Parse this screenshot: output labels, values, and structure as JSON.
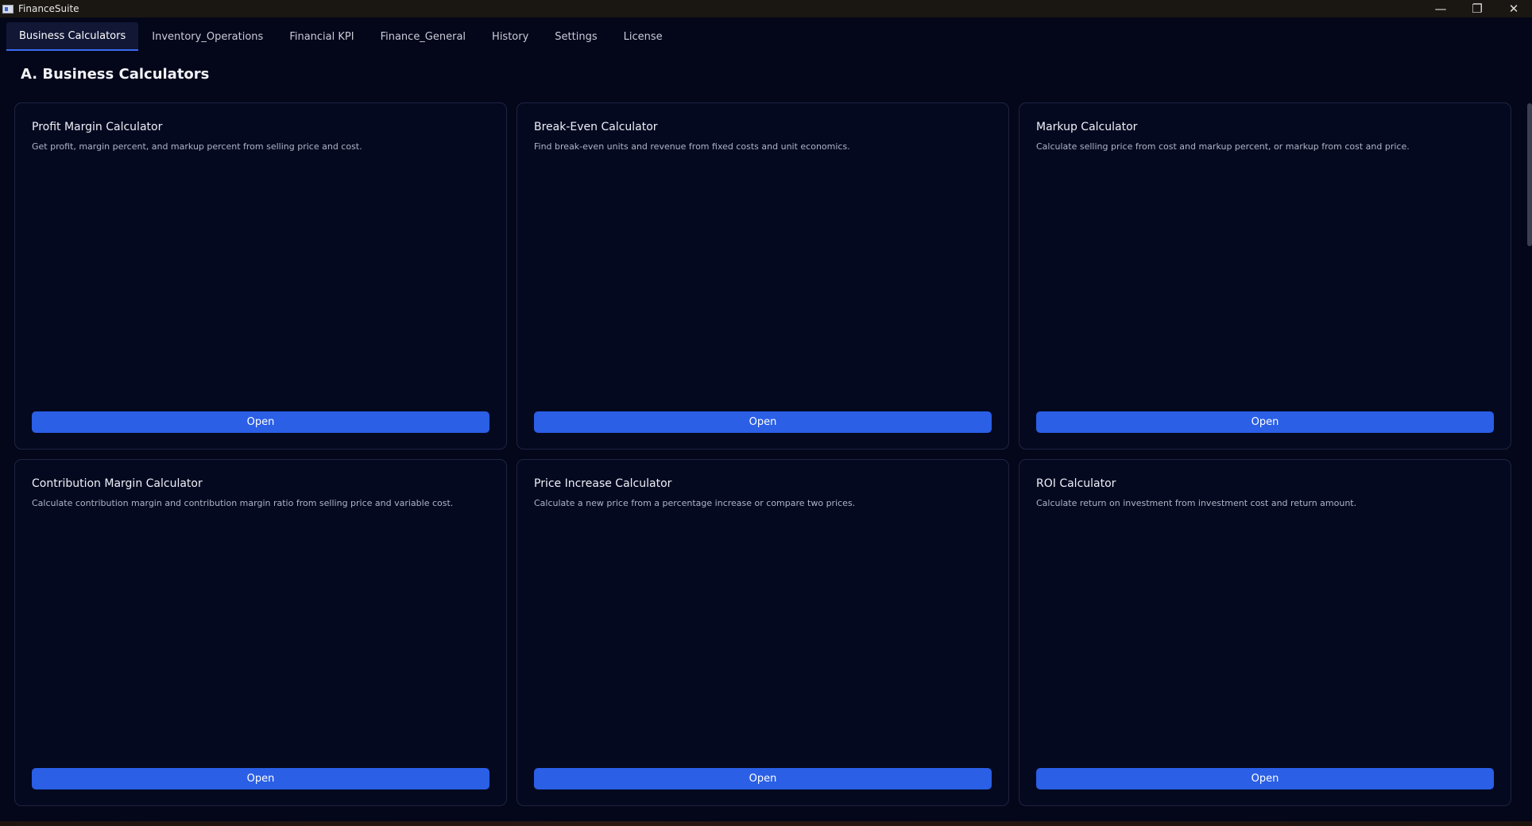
{
  "window": {
    "title": "FinanceSuite",
    "controls": {
      "minimize": "—",
      "restore": "❐",
      "close": "✕"
    }
  },
  "tabs": [
    {
      "label": "Business Calculators",
      "active": true
    },
    {
      "label": "Inventory_Operations",
      "active": false
    },
    {
      "label": "Financial KPI",
      "active": false
    },
    {
      "label": "Finance_General",
      "active": false
    },
    {
      "label": "History",
      "active": false
    },
    {
      "label": "Settings",
      "active": false
    },
    {
      "label": "License",
      "active": false
    }
  ],
  "page": {
    "heading": "A. Business Calculators"
  },
  "cards": [
    {
      "title": "Profit Margin Calculator",
      "description": "Get profit, margin percent, and markup percent from selling price and cost.",
      "button_label": "Open"
    },
    {
      "title": "Break-Even Calculator",
      "description": "Find break-even units and revenue from fixed costs and unit economics.",
      "button_label": "Open"
    },
    {
      "title": "Markup Calculator",
      "description": "Calculate selling price from cost and markup percent, or markup from cost and price.",
      "button_label": "Open"
    },
    {
      "title": "Contribution Margin Calculator",
      "description": "Calculate contribution margin and contribution margin ratio from selling price and variable cost.",
      "button_label": "Open"
    },
    {
      "title": "Price Increase Calculator",
      "description": "Calculate a new price from a percentage increase or compare two prices.",
      "button_label": "Open"
    },
    {
      "title": "ROI Calculator",
      "description": "Calculate return on investment from investment cost and return amount.",
      "button_label": "Open"
    }
  ],
  "colors": {
    "background": "#04061a",
    "card_background": "#050920",
    "accent": "#2a5fe6",
    "tab_indicator": "#3b6cf0"
  }
}
